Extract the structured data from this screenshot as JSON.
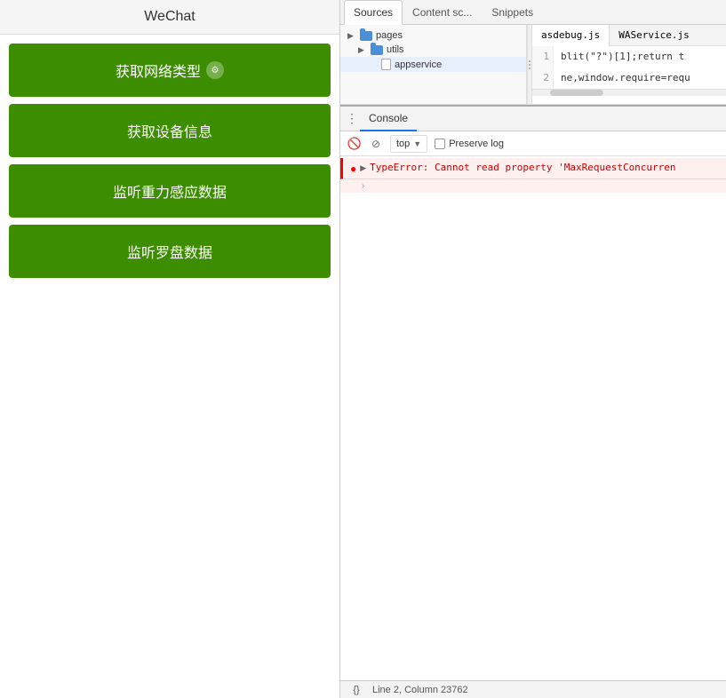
{
  "wechat": {
    "title": "WeChat",
    "buttons": [
      {
        "id": "btn-network",
        "label": "获取网络类型",
        "has_icon": true
      },
      {
        "id": "btn-device",
        "label": "获取设备信息",
        "has_icon": false
      },
      {
        "id": "btn-gravity",
        "label": "监听重力感应数据",
        "has_icon": false
      },
      {
        "id": "btn-compass",
        "label": "监听罗盘数据",
        "has_icon": false
      }
    ]
  },
  "devtools": {
    "sources_tabs": [
      "Sources",
      "Content sc...",
      "Snippets"
    ],
    "right_tabs": [
      "asdebug.js",
      "WAService.js"
    ],
    "tree": {
      "items": [
        {
          "type": "folder",
          "label": "pages",
          "expanded": true,
          "indent": 0
        },
        {
          "type": "folder",
          "label": "utils",
          "expanded": true,
          "indent": 1
        },
        {
          "type": "file",
          "label": "appservice",
          "indent": 2,
          "selected": true
        }
      ]
    },
    "code_lines": [
      {
        "num": "1",
        "content": "blit(\"?\")[1];return t"
      },
      {
        "num": "2",
        "content": "ne,window.require=requ"
      }
    ],
    "console": {
      "tab_label": "Console",
      "options_icon": "⋮",
      "toolbar": {
        "block_icon": "🚫",
        "filter_icon": "⊘",
        "context_label": "top",
        "context_arrow": "▼",
        "preserve_log_label": "Preserve log",
        "preserve_log_checked": false
      },
      "error_message": "TypeError: Cannot read property 'MaxRequestConcurren",
      "arrow_symbol": "›"
    },
    "status_bar": {
      "format_icon": "{}",
      "text": "Line 2, Column 23762"
    }
  }
}
